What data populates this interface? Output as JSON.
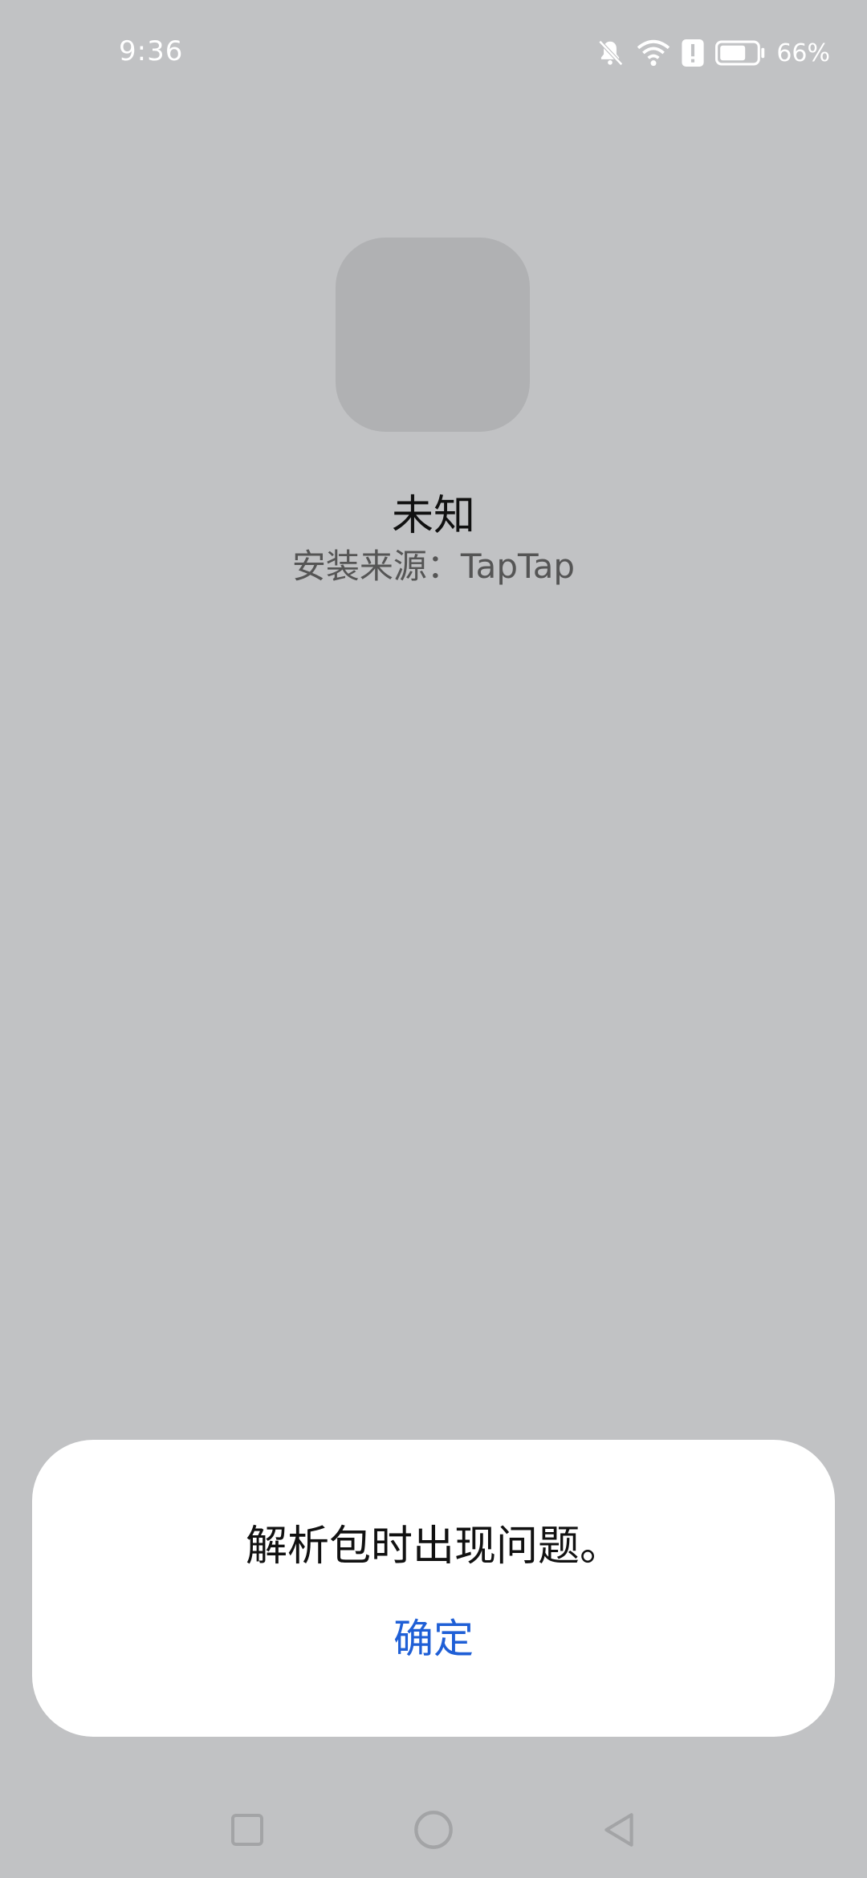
{
  "status_bar": {
    "time": "9:36",
    "battery_percent": "66%",
    "battery_level": 0.66,
    "icons": [
      "notifications-muted-icon",
      "wifi-icon",
      "alert-icon",
      "battery-icon"
    ]
  },
  "app": {
    "name": "未知",
    "install_source": "安装来源：TapTap"
  },
  "dialog": {
    "message": "解析包时出现问题。",
    "ok_label": "确定",
    "ok_color": "#1f5fd6"
  },
  "nav_bar": {
    "buttons": [
      "recents-icon",
      "home-icon",
      "back-icon"
    ]
  },
  "colors": {
    "background": "#c1c2c4",
    "icon_placeholder": "#b0b1b3"
  }
}
